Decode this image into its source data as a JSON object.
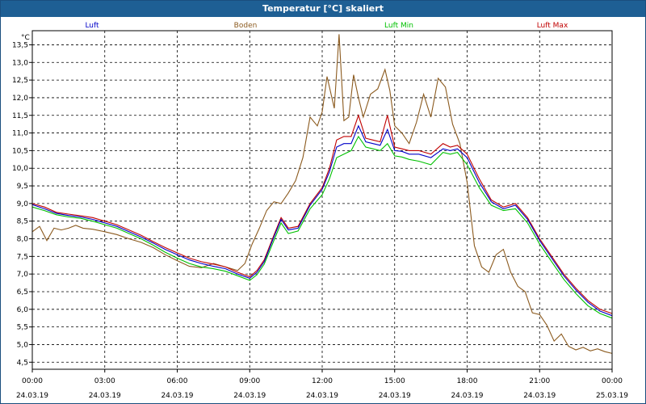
{
  "window": {
    "title": "Temperatur [°C] skaliert"
  },
  "chart_data": {
    "type": "line",
    "title": "Temperatur [°C] skaliert",
    "ylabel": "°C",
    "xlim": [
      0,
      24
    ],
    "ylim": [
      4.3,
      13.9
    ],
    "grid": true,
    "legend_position": "top",
    "y_ticks": [
      4.5,
      5.0,
      5.5,
      6.0,
      6.5,
      7.0,
      7.5,
      8.0,
      8.5,
      9.0,
      9.5,
      10.0,
      10.5,
      11.0,
      11.5,
      12.0,
      12.5,
      13.0,
      13.5
    ],
    "y_tick_labels": [
      "4,5",
      "5,0",
      "5,5",
      "6,0",
      "6,5",
      "7,0",
      "7,5",
      "8,0",
      "8,5",
      "9,0",
      "9,5",
      "10,0",
      "10,5",
      "11,0",
      "11,5",
      "12,0",
      "12,5",
      "13,0",
      "13,5"
    ],
    "x_ticks": [
      {
        "t": 0,
        "time": "00:00",
        "date": "24.03.19"
      },
      {
        "t": 3,
        "time": "03:00",
        "date": "24.03.19"
      },
      {
        "t": 6,
        "time": "06:00",
        "date": "24.03.19"
      },
      {
        "t": 9,
        "time": "09:00",
        "date": "24.03.19"
      },
      {
        "t": 12,
        "time": "12:00",
        "date": "24.03.19"
      },
      {
        "t": 15,
        "time": "15:00",
        "date": "24.03.19"
      },
      {
        "t": 18,
        "time": "18:00",
        "date": "24.03.19"
      },
      {
        "t": 21,
        "time": "21:00",
        "date": "24.03.19"
      },
      {
        "t": 24,
        "time": "00:00",
        "date": "25.03.19"
      }
    ],
    "series": [
      {
        "name": "Luft",
        "color": "#0000c8",
        "x": [
          0,
          0.5,
          1,
          1.5,
          2,
          2.5,
          3,
          3.5,
          4,
          4.5,
          5,
          5.5,
          6,
          6.5,
          7,
          7.5,
          8,
          8.5,
          9,
          9.3,
          9.6,
          10,
          10.3,
          10.6,
          11,
          11.5,
          12,
          12.3,
          12.6,
          12.9,
          13.2,
          13.5,
          13.8,
          14.1,
          14.4,
          14.7,
          15,
          15.3,
          15.6,
          16,
          16.5,
          17,
          17.3,
          17.6,
          18,
          18.5,
          19,
          19.5,
          20,
          20.5,
          21,
          21.5,
          22,
          22.5,
          23,
          23.5,
          24
        ],
        "y": [
          8.97,
          8.85,
          8.72,
          8.66,
          8.62,
          8.55,
          8.45,
          8.35,
          8.2,
          8.05,
          7.88,
          7.7,
          7.55,
          7.4,
          7.3,
          7.22,
          7.15,
          7.0,
          6.88,
          7.05,
          7.35,
          8.05,
          8.55,
          8.25,
          8.3,
          8.95,
          9.4,
          9.9,
          10.6,
          10.7,
          10.7,
          11.2,
          10.75,
          10.7,
          10.65,
          11.1,
          10.5,
          10.48,
          10.4,
          10.4,
          10.3,
          10.55,
          10.5,
          10.55,
          10.3,
          9.6,
          9.05,
          8.85,
          8.95,
          8.55,
          7.95,
          7.45,
          6.95,
          6.55,
          6.2,
          5.95,
          5.82
        ]
      },
      {
        "name": "Boden",
        "color": "#8b5a1e",
        "x": [
          0,
          0.3,
          0.6,
          0.9,
          1.2,
          1.5,
          1.8,
          2.1,
          2.5,
          3,
          3.5,
          4,
          4.5,
          5,
          5.5,
          6,
          6.5,
          7,
          7.5,
          8,
          8.5,
          8.8,
          9.1,
          9.4,
          9.7,
          10,
          10.3,
          10.6,
          10.9,
          11.2,
          11.5,
          11.8,
          12,
          12.2,
          12.5,
          12.7,
          12.9,
          13.1,
          13.3,
          13.5,
          13.7,
          14,
          14.3,
          14.6,
          14.8,
          15,
          15.3,
          15.6,
          15.9,
          16.2,
          16.5,
          16.8,
          17.1,
          17.4,
          17.7,
          18,
          18.3,
          18.6,
          18.9,
          19.2,
          19.5,
          19.8,
          20.1,
          20.4,
          20.7,
          21,
          21.3,
          21.6,
          21.9,
          22.2,
          22.5,
          22.8,
          23.1,
          23.4,
          23.7,
          24
        ],
        "y": [
          8.2,
          8.35,
          7.95,
          8.3,
          8.25,
          8.3,
          8.38,
          8.3,
          8.27,
          8.2,
          8.12,
          8.0,
          7.9,
          7.75,
          7.55,
          7.38,
          7.22,
          7.18,
          7.3,
          7.2,
          7.1,
          7.3,
          7.85,
          8.3,
          8.8,
          9.05,
          9.0,
          9.3,
          9.65,
          10.3,
          11.45,
          11.2,
          11.6,
          12.6,
          11.7,
          13.8,
          11.35,
          11.45,
          12.65,
          12.0,
          11.45,
          12.1,
          12.25,
          12.8,
          12.2,
          11.2,
          11.0,
          10.7,
          11.3,
          12.1,
          11.45,
          12.55,
          12.3,
          11.25,
          10.7,
          9.6,
          7.8,
          7.2,
          7.05,
          7.55,
          7.7,
          7.05,
          6.65,
          6.5,
          5.9,
          5.85,
          5.55,
          5.1,
          5.3,
          4.95,
          4.85,
          4.92,
          4.82,
          4.88,
          4.8,
          4.75
        ]
      },
      {
        "name": "Luft Min",
        "color": "#00c000",
        "x": [
          0,
          0.5,
          1,
          1.5,
          2,
          2.5,
          3,
          3.5,
          4,
          4.5,
          5,
          5.5,
          6,
          6.5,
          7,
          7.5,
          8,
          8.5,
          9,
          9.3,
          9.6,
          10,
          10.3,
          10.6,
          11,
          11.5,
          12,
          12.3,
          12.6,
          12.9,
          13.2,
          13.5,
          13.8,
          14.1,
          14.4,
          14.7,
          15,
          15.3,
          15.6,
          16,
          16.5,
          17,
          17.3,
          17.6,
          18,
          18.5,
          19,
          19.5,
          20,
          20.5,
          21,
          21.5,
          22,
          22.5,
          23,
          23.5,
          24
        ],
        "y": [
          8.9,
          8.8,
          8.68,
          8.62,
          8.58,
          8.5,
          8.4,
          8.3,
          8.15,
          8.0,
          7.82,
          7.62,
          7.45,
          7.3,
          7.2,
          7.15,
          7.08,
          6.95,
          6.82,
          6.98,
          7.28,
          7.95,
          8.45,
          8.15,
          8.22,
          8.85,
          9.25,
          9.7,
          10.3,
          10.4,
          10.5,
          10.9,
          10.6,
          10.55,
          10.5,
          10.7,
          10.35,
          10.32,
          10.25,
          10.2,
          10.1,
          10.45,
          10.4,
          10.45,
          10.1,
          9.45,
          8.95,
          8.8,
          8.85,
          8.45,
          7.85,
          7.35,
          6.85,
          6.45,
          6.1,
          5.88,
          5.75
        ]
      },
      {
        "name": "Luft Max",
        "color": "#c00000",
        "x": [
          0,
          0.5,
          1,
          1.5,
          2,
          2.5,
          3,
          3.5,
          4,
          4.5,
          5,
          5.5,
          6,
          6.5,
          7,
          7.5,
          8,
          8.5,
          9,
          9.3,
          9.6,
          10,
          10.3,
          10.6,
          11,
          11.5,
          12,
          12.3,
          12.6,
          12.9,
          13.2,
          13.5,
          13.8,
          14.1,
          14.4,
          14.7,
          15,
          15.3,
          15.6,
          16,
          16.5,
          17,
          17.3,
          17.6,
          18,
          18.5,
          19,
          19.5,
          20,
          20.5,
          21,
          21.5,
          22,
          22.5,
          23,
          23.5,
          24
        ],
        "y": [
          9.0,
          8.9,
          8.75,
          8.7,
          8.65,
          8.6,
          8.5,
          8.4,
          8.25,
          8.1,
          7.92,
          7.75,
          7.6,
          7.45,
          7.35,
          7.28,
          7.2,
          7.05,
          6.92,
          7.1,
          7.4,
          8.1,
          8.6,
          8.3,
          8.35,
          9.0,
          9.45,
          10.0,
          10.8,
          10.9,
          10.9,
          11.5,
          10.85,
          10.8,
          10.75,
          11.5,
          10.6,
          10.55,
          10.5,
          10.5,
          10.4,
          10.7,
          10.6,
          10.65,
          10.4,
          9.7,
          9.1,
          8.9,
          9.0,
          8.6,
          8.0,
          7.5,
          7.0,
          6.6,
          6.25,
          6.0,
          5.88
        ]
      }
    ]
  }
}
